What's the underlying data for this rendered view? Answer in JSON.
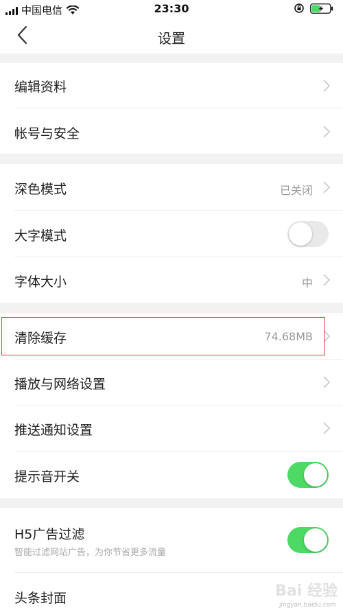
{
  "status_bar": {
    "carrier": "中国电信",
    "time": "23:30"
  },
  "nav": {
    "title": "设置"
  },
  "sections": [
    {
      "items": [
        {
          "label": "编辑资料",
          "type": "link"
        },
        {
          "label": "帐号与安全",
          "type": "link"
        }
      ]
    },
    {
      "items": [
        {
          "label": "深色模式",
          "value": "已关闭",
          "type": "link"
        },
        {
          "label": "大字模式",
          "type": "toggle",
          "enabled": false
        },
        {
          "label": "字体大小",
          "value": "中",
          "type": "link"
        }
      ]
    },
    {
      "items": [
        {
          "label": "清除缓存",
          "value": "74.68MB",
          "type": "link",
          "highlighted": true
        },
        {
          "label": "播放与网络设置",
          "type": "link"
        },
        {
          "label": "推送通知设置",
          "type": "link"
        },
        {
          "label": "提示音开关",
          "type": "toggle",
          "enabled": true
        }
      ]
    },
    {
      "items": [
        {
          "label": "H5广告过滤",
          "subtitle": "智能过滤网站广告，为你节省更多流量",
          "type": "toggle",
          "enabled": true
        },
        {
          "label": "头条封面",
          "type": "link"
        }
      ]
    }
  ],
  "watermark": {
    "text": "Bai 经验",
    "url": "jingyan.baidu.com"
  },
  "colors": {
    "toggle_on": "#4cd964",
    "toggle_off": "#e9e9e9",
    "highlight_border": "#e53935",
    "section_gap": "#f2f2f2"
  }
}
